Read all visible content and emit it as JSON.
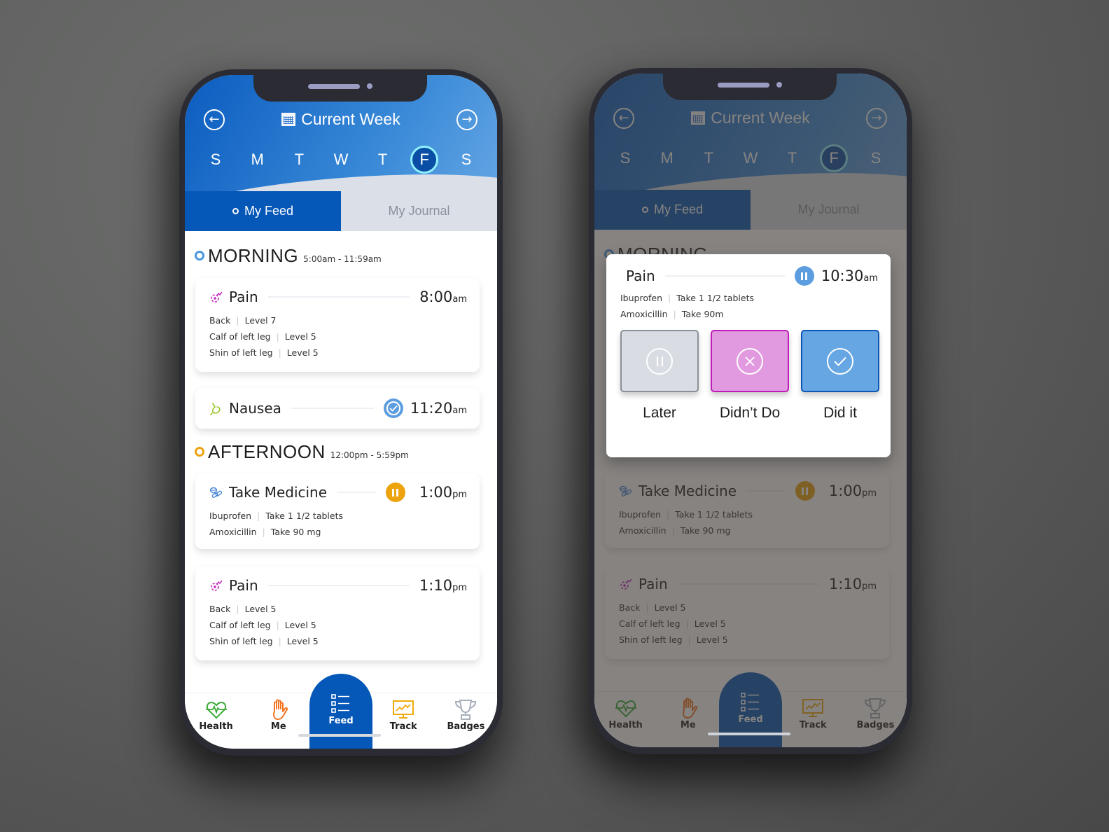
{
  "colors": {
    "brand_blue": "#0557b8",
    "header_gradient_end": "#6aa9e5",
    "selected_day_ring": "#8ff2fb",
    "morning_ring": "#4a96e0",
    "afternoon_ring": "#eda30d",
    "status_done": "#5c9de0",
    "status_pause": "#eda30d",
    "pain_icon": "#c32ac0",
    "nausea_icon": "#9ac52a",
    "medicine_icon": "#4a86d6",
    "health_icon": "#3aaa35",
    "me_icon": "#f47421",
    "track_icon": "#f0aa0b",
    "badges_icon": "#a7afbb"
  },
  "header": {
    "prev_icon": "arrow-left-circle-icon",
    "next_icon": "arrow-right-circle-icon",
    "calendar_icon": "calendar-icon",
    "title": "Current Week",
    "days": [
      "S",
      "M",
      "T",
      "W",
      "T",
      "F",
      "S"
    ],
    "selected_day": "F"
  },
  "tabs": [
    {
      "label": "My Feed",
      "active": true
    },
    {
      "label": "My Journal",
      "active": false
    }
  ],
  "feed": {
    "sections": [
      {
        "title": "MORNING",
        "range": "5:00am - 11:59am",
        "cards": [
          {
            "icon": "pain-icon",
            "title": "Pain",
            "time": "8:00",
            "suffix": "am",
            "status": null,
            "rows": [
              [
                "Back",
                "Level 7"
              ],
              [
                "Calf of left leg",
                "Level 5"
              ],
              [
                "Shin of left leg",
                "Level 5"
              ]
            ]
          },
          {
            "icon": "nausea-icon",
            "title": "Nausea",
            "time": "11:20",
            "suffix": "am",
            "status": "done",
            "rows": []
          }
        ]
      },
      {
        "title": "AFTERNOON",
        "range": "12:00pm - 5:59pm",
        "cards": [
          {
            "icon": "medicine-icon",
            "title": "Take Medicine",
            "time": "1:00",
            "suffix": "pm",
            "status": "paused",
            "rows": [
              [
                "Ibuprofen",
                "Take 1 1/2 tablets"
              ],
              [
                "Amoxicillin",
                "Take 90 mg"
              ]
            ]
          },
          {
            "icon": "pain-icon",
            "title": "Pain",
            "time": "1:10",
            "suffix": "pm",
            "status": null,
            "rows": [
              [
                "Back",
                "Level 5"
              ],
              [
                "Calf of left leg",
                "Level 5"
              ],
              [
                "Shin of left leg",
                "Level 5"
              ]
            ]
          }
        ]
      }
    ]
  },
  "bottom_nav": [
    {
      "label": "Health",
      "icon": "heart-pulse-icon",
      "active": false
    },
    {
      "label": "Me",
      "icon": "hand-icon",
      "active": false
    },
    {
      "label": "Feed",
      "icon": "list-icon",
      "active": true
    },
    {
      "label": "Track",
      "icon": "chart-monitor-icon",
      "active": false
    },
    {
      "label": "Badges",
      "icon": "trophy-icon",
      "active": false
    }
  ],
  "modal": {
    "title": "Pain",
    "time": "10:30",
    "suffix": "am",
    "status": "paused",
    "rows": [
      [
        "Ibuprofen",
        "Take 1 1/2 tablets"
      ],
      [
        "Amoxicillin",
        "Take 90m"
      ]
    ],
    "actions": [
      {
        "label": "Later",
        "icon": "pause-icon"
      },
      {
        "label": "Didn’t Do",
        "icon": "x-circle-icon"
      },
      {
        "label": "Did it",
        "icon": "check-circle-icon"
      }
    ]
  }
}
